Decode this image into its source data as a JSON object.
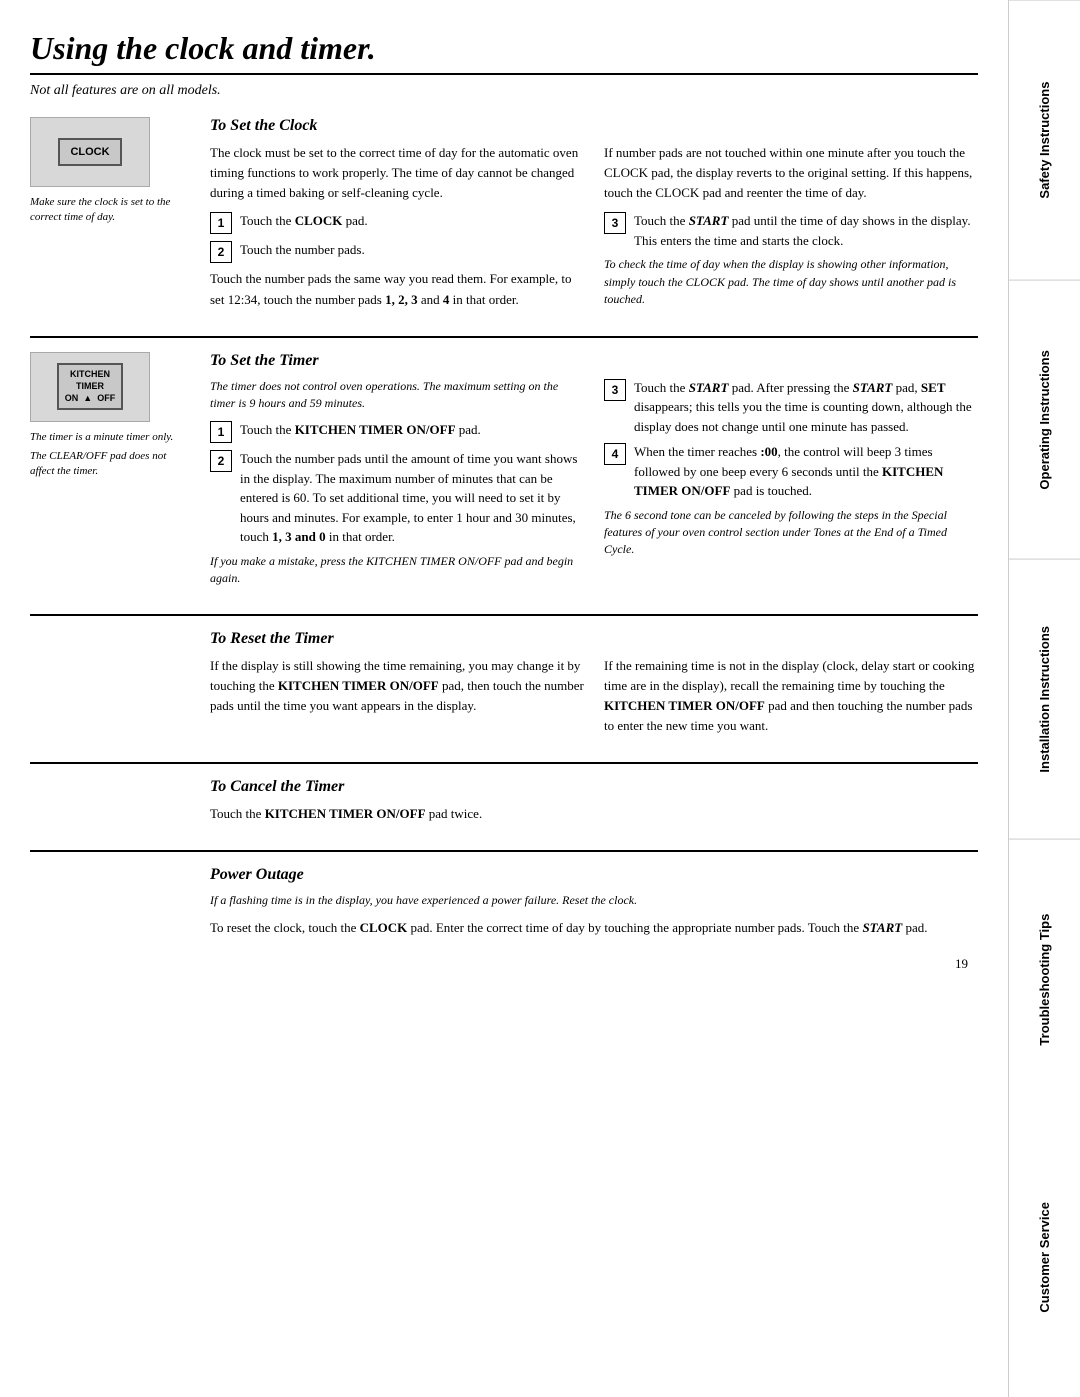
{
  "page": {
    "title": "Using the clock and timer.",
    "subtitle": "Not all features are on all models.",
    "page_number": "19"
  },
  "sidebar": {
    "sections": [
      "Safety Instructions",
      "Operating Instructions",
      "Installation Instructions",
      "Troubleshooting Tips",
      "Customer Service"
    ]
  },
  "clock_section": {
    "heading": "To Set the Clock",
    "device_label": "CLOCK",
    "caption": "Make sure the clock is set to the correct time of day.",
    "body1": "The clock must be set to the correct time of day for the automatic oven timing functions to work properly. The time of day cannot be changed during a timed baking or self-cleaning cycle.",
    "steps": [
      "Touch the CLOCK pad.",
      "Touch the number pads."
    ],
    "body2": "Touch the number pads the same way you read them. For example, to set 12:34, touch the number pads 1, 2, 3 and 4 in that order.",
    "right_col": {
      "body1": "If number pads are not touched within one minute after you touch the CLOCK pad, the display reverts to the original setting. If this happens, touch the CLOCK pad and reenter the time of day.",
      "step3": "Touch the START pad until the time of day shows in the display. This enters the time and starts the clock.",
      "italic_note": "To check the time of day when the display is showing other information, simply touch the CLOCK pad. The time of day shows until another pad is touched."
    }
  },
  "timer_section": {
    "heading": "To Set the Timer",
    "device_labels": [
      "KITCHEN",
      "TIMER",
      "ON  OFF"
    ],
    "caption1": "The timer is a minute timer only.",
    "caption2": "The CLEAR/OFF pad does not affect the timer.",
    "italic_note": "The timer does not control oven operations. The maximum setting on the timer is 9 hours and 59 minutes.",
    "steps": [
      {
        "num": "1",
        "text": "Touch the KITCHEN TIMER ON/OFF pad."
      },
      {
        "num": "2",
        "text": "Touch the number pads until the amount of time you want shows in the display. The maximum number of minutes that can be entered is 60. To set additional time, you will need to set it by hours and minutes. For example, to enter 1 hour and 30 minutes, touch 1, 3 and 0 in that order."
      }
    ],
    "italic_note2": "If you make a mistake, press the KITCHEN TIMER ON/OFF pad and begin again.",
    "right_col": {
      "steps": [
        {
          "num": "3",
          "text": "Touch the START pad. After pressing the START pad, SET disappears; this tells you the time is counting down, although the display does not change until one minute has passed."
        },
        {
          "num": "4",
          "text": "When the timer reaches :00, the control will beep 3 times followed by one beep every 6 seconds until the KITCHEN TIMER ON/OFF pad is touched."
        }
      ],
      "italic_note": "The 6 second tone can be canceled by following the steps in the Special features of your oven control section under Tones at the End of a Timed Cycle."
    }
  },
  "reset_section": {
    "heading": "To Reset the Timer",
    "body_left": "If the display is still showing the time remaining, you may change it by touching the KITCHEN TIMER ON/OFF pad, then touch the number pads until the time you want appears in the display.",
    "body_right": "If the remaining time is not in the display (clock, delay start or cooking time are in the display), recall the remaining time by touching the KITCHEN TIMER ON/OFF pad and then touching the number pads to enter the new time you want."
  },
  "cancel_section": {
    "heading": "To Cancel the Timer",
    "body": "Touch the KITCHEN TIMER ON/OFF pad twice."
  },
  "power_section": {
    "heading": "Power Outage",
    "italic_note": "If a flashing time is in the display, you have experienced a power failure. Reset the clock.",
    "body": "To reset the clock, touch the CLOCK pad. Enter the correct time of day by touching the appropriate number pads. Touch the START pad."
  }
}
